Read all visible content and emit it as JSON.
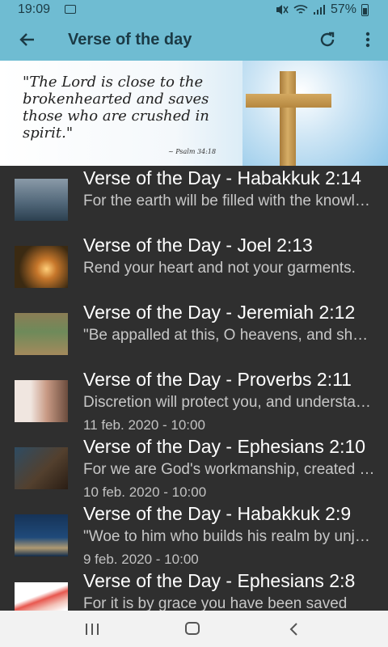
{
  "status_bar": {
    "time": "19:09",
    "battery": "57%"
  },
  "app_bar": {
    "title": "Verse of the day"
  },
  "banner": {
    "quote": "\"The Lord is close to the brokenhearted and saves those who are crushed in spirit.\"",
    "reference": "~ Psalm 34:18"
  },
  "items": [
    {
      "title": "Verse of the Day - Habakkuk 2:14",
      "snippet": "For the earth will be filled with the knowledge",
      "date": ""
    },
    {
      "title": "Verse of the Day - Joel 2:13",
      "snippet": "Rend your heart and not your garments.",
      "date": ""
    },
    {
      "title": "Verse of the Day - Jeremiah 2:12",
      "snippet": "\"Be appalled at this, O heavens, and shudder",
      "date": ""
    },
    {
      "title": "Verse of the Day - Proverbs 2:11",
      "snippet": "Discretion will protect you, and understanding",
      "date": "11 feb. 2020 - 10:00"
    },
    {
      "title": "Verse of the Day - Ephesians 2:10",
      "snippet": "For we are God's workmanship, created in Christ",
      "date": "10 feb. 2020 - 10:00"
    },
    {
      "title": "Verse of the Day - Habakkuk 2:9",
      "snippet": "\"Woe to him who builds his realm by unjust gain",
      "date": "9 feb. 2020 - 10:00"
    },
    {
      "title": "Verse of the Day - Ephesians 2:8",
      "snippet": "For it is by grace you have been saved",
      "date": ""
    }
  ]
}
